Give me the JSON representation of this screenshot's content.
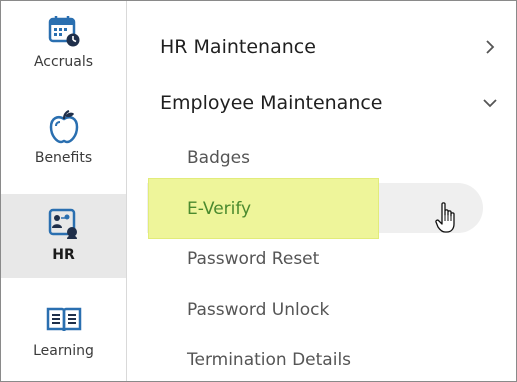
{
  "rail": {
    "items": [
      {
        "label": "Accruals",
        "icon": "calendar-clock-icon"
      },
      {
        "label": "Benefits",
        "icon": "apple-icon"
      },
      {
        "label": "HR",
        "icon": "people-org-icon",
        "active": true
      },
      {
        "label": "Learning",
        "icon": "open-book-icon"
      }
    ]
  },
  "menu": {
    "hr_maintenance": "HR Maintenance",
    "employee_maintenance": "Employee Maintenance",
    "sub_items": [
      {
        "label": "Badges"
      },
      {
        "label": "E-Verify",
        "highlighted": true
      },
      {
        "label": "Password Reset"
      },
      {
        "label": "Password Unlock"
      },
      {
        "label": "Termination Details"
      }
    ]
  },
  "colors": {
    "accent_blue": "#2a6fb0",
    "highlight_yellow": "#eef59a",
    "active_text_green": "#4a8a2e",
    "active_rail_bg": "#e8e8e8"
  }
}
